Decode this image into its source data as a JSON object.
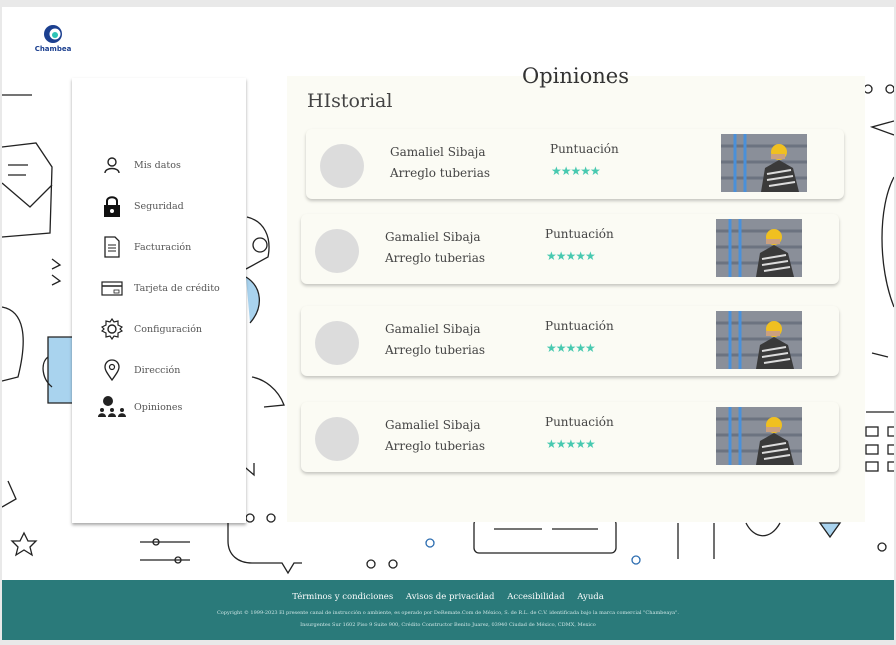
{
  "brand": {
    "name": "Chambea",
    "primary_color": "#1b3f8f",
    "accent_color": "#2ec4b6"
  },
  "sidebar": {
    "items": [
      {
        "label": "Mis datos",
        "icon": "user-icon"
      },
      {
        "label": "Seguridad",
        "icon": "lock-icon"
      },
      {
        "label": "Facturación",
        "icon": "invoice-icon"
      },
      {
        "label": "Tarjeta de crédito",
        "icon": "credit-card-icon"
      },
      {
        "label": "Configuración",
        "icon": "gear-icon"
      },
      {
        "label": "Dirección",
        "icon": "location-pin-icon"
      },
      {
        "label": "Opiniones",
        "icon": "people-icon"
      }
    ]
  },
  "main": {
    "title": "Opiniones",
    "subtitle": "HIstorial",
    "reviews": [
      {
        "name": "Gamaliel Sibaja",
        "service": "Arreglo tuberias",
        "score_label": "Puntuación",
        "stars": "★★★★★",
        "rating": 5
      },
      {
        "name": "Gamaliel Sibaja",
        "service": "Arreglo tuberias",
        "score_label": "Puntuación",
        "stars": "★★★★★",
        "rating": 5
      },
      {
        "name": "Gamaliel Sibaja",
        "service": "Arreglo tuberias",
        "score_label": "Puntuación",
        "stars": "★★★★★",
        "rating": 5
      },
      {
        "name": "Gamaliel Sibaja",
        "service": "Arreglo tuberias",
        "score_label": "Puntuación",
        "stars": "★★★★★",
        "rating": 5
      }
    ]
  },
  "footer": {
    "links": [
      "Términos y condiciones",
      "Avisos de privacidad",
      "Accesibilidad",
      "Ayuda"
    ],
    "copyright": "Copyright © 1999-2023 El presente canal de instrucción o ambiente, es operado por DeRemate.Com de México, S. de R.L. de C.V. identificada bajo la marca comercial \"Chambeaya\".",
    "address": "Insurgentes Sur 1602 Piso 9 Suite 900, Crédito Constructor Benito Juarez, 03940 Ciudad de México, CDMX, Mexico",
    "background": "#2a7a7a"
  }
}
